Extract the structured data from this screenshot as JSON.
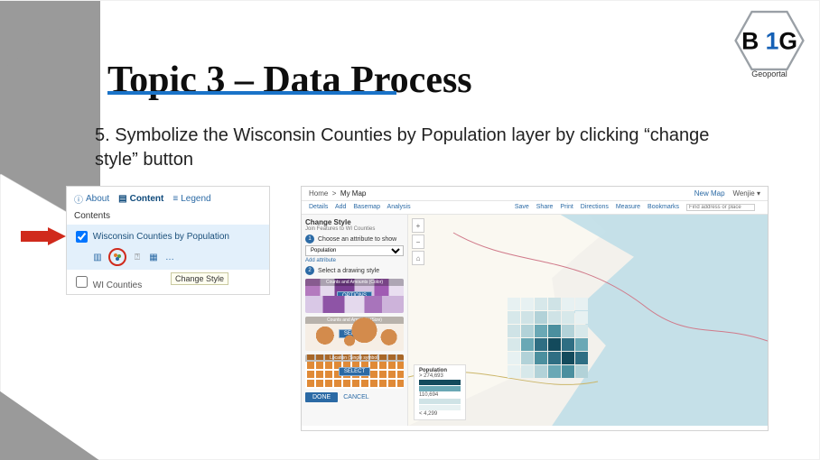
{
  "title": "Topic 3 – Data Process",
  "logo": {
    "brand": "B1G",
    "sub": "Geoportal"
  },
  "step": "5. Symbolize the Wisconsin Counties by Population layer by clicking “change style” button",
  "contents_panel": {
    "tabs": {
      "about": "About",
      "content": "Content",
      "legend": "Legend"
    },
    "heading": "Contents",
    "layer1": "Wisconsin Counties by Population",
    "tooltip": "Change Style",
    "layer2": "WI Counties",
    "more": "…"
  },
  "map_panel": {
    "breadcrumb_home": "Home",
    "breadcrumb_map": "My Map",
    "new_map": "New Map",
    "user": "Wenjie",
    "toolbar": {
      "details": "Details",
      "add": "Add",
      "basemap": "Basemap",
      "analysis": "Analysis",
      "save": "Save",
      "share": "Share",
      "print": "Print",
      "directions": "Directions",
      "measure": "Measure",
      "bookmarks": "Bookmarks",
      "search_placeholder": "Find address or place"
    },
    "change_style": {
      "title": "Change Style",
      "subtitle": "Join Features to WI Counties",
      "step1": "Choose an attribute to show",
      "attribute": "Population",
      "add_attr": "Add attribute",
      "step2": "Select a drawing style",
      "card1": "Counts and Amounts (Color)",
      "card2": "Counts and Amounts (Size)",
      "card3": "Location (Single symbol)",
      "options": "OPTIONS",
      "select": "SELECT",
      "done": "DONE",
      "cancel": "CANCEL"
    },
    "legend": {
      "title": "Population",
      "high": "> 274,693",
      "mid": "110,694",
      "low": "< 4,299"
    },
    "zoom": {
      "in": "+",
      "out": "−",
      "home": "⌂"
    }
  },
  "chart_data": {
    "type": "heatmap",
    "title": "Wisconsin Counties by Population (choropleth)",
    "legend_label": "Population",
    "breaks": [
      4299,
      110694,
      274693
    ],
    "colors_low_to_high": [
      "#e7f1f2",
      "#b2d2d8",
      "#6aa8b5",
      "#2f6e83",
      "#134a5c"
    ],
    "note": "Approximate: darker teal = higher county population. SE Wisconsin (Milwaukee area) darkest; northern counties lightest."
  }
}
